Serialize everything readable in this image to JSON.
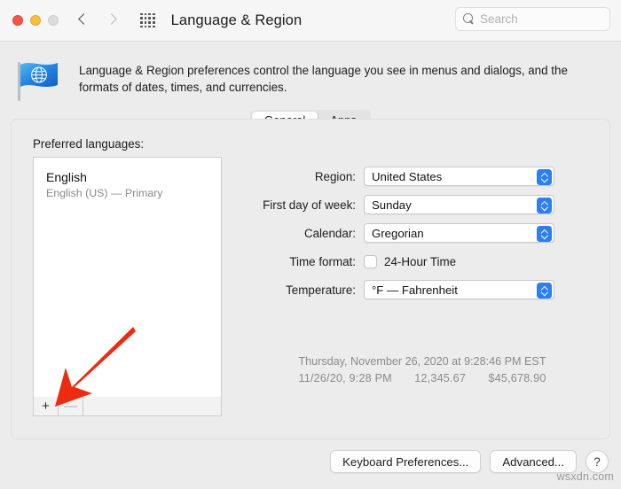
{
  "window": {
    "title": "Language & Region",
    "traffic_lights": [
      "close",
      "minimize",
      "zoom"
    ],
    "back_icon": "chevron-left-icon",
    "forward_icon": "chevron-right-icon",
    "show_all_icon": "grid-icon"
  },
  "search": {
    "placeholder": "Search",
    "value": "",
    "icon": "search-icon"
  },
  "header": {
    "icon": "flag-globe-icon",
    "description": "Language & Region preferences control the language you see in menus and dialogs, and the formats of dates, times, and currencies."
  },
  "tabs": [
    {
      "label": "General",
      "active": true
    },
    {
      "label": "Apps",
      "active": false
    }
  ],
  "languages": {
    "section_label": "Preferred languages:",
    "items": [
      {
        "name": "English",
        "subtitle": "English (US) — Primary"
      }
    ],
    "add_button": "+",
    "remove_button": "—"
  },
  "settings": {
    "region": {
      "label": "Region:",
      "value": "United States"
    },
    "first_day": {
      "label": "First day of week:",
      "value": "Sunday"
    },
    "calendar": {
      "label": "Calendar:",
      "value": "Gregorian"
    },
    "time_format": {
      "label": "Time format:",
      "checkbox_label": "24-Hour Time",
      "checked": false
    },
    "temperature": {
      "label": "Temperature:",
      "value": "°F — Fahrenheit"
    }
  },
  "preview": {
    "line1": "Thursday, November 26, 2020 at 9:28:46 PM EST",
    "line2_date": "11/26/20, 9:28 PM",
    "line2_number": "12,345.67",
    "line2_currency": "$45,678.90"
  },
  "footer": {
    "keyboard_preferences": "Keyboard Preferences...",
    "advanced": "Advanced...",
    "help": "?"
  },
  "annotation": {
    "arrow_color": "#ee2a11",
    "arrow_target": "add-language-button"
  },
  "watermark": "wsxdn.com"
}
